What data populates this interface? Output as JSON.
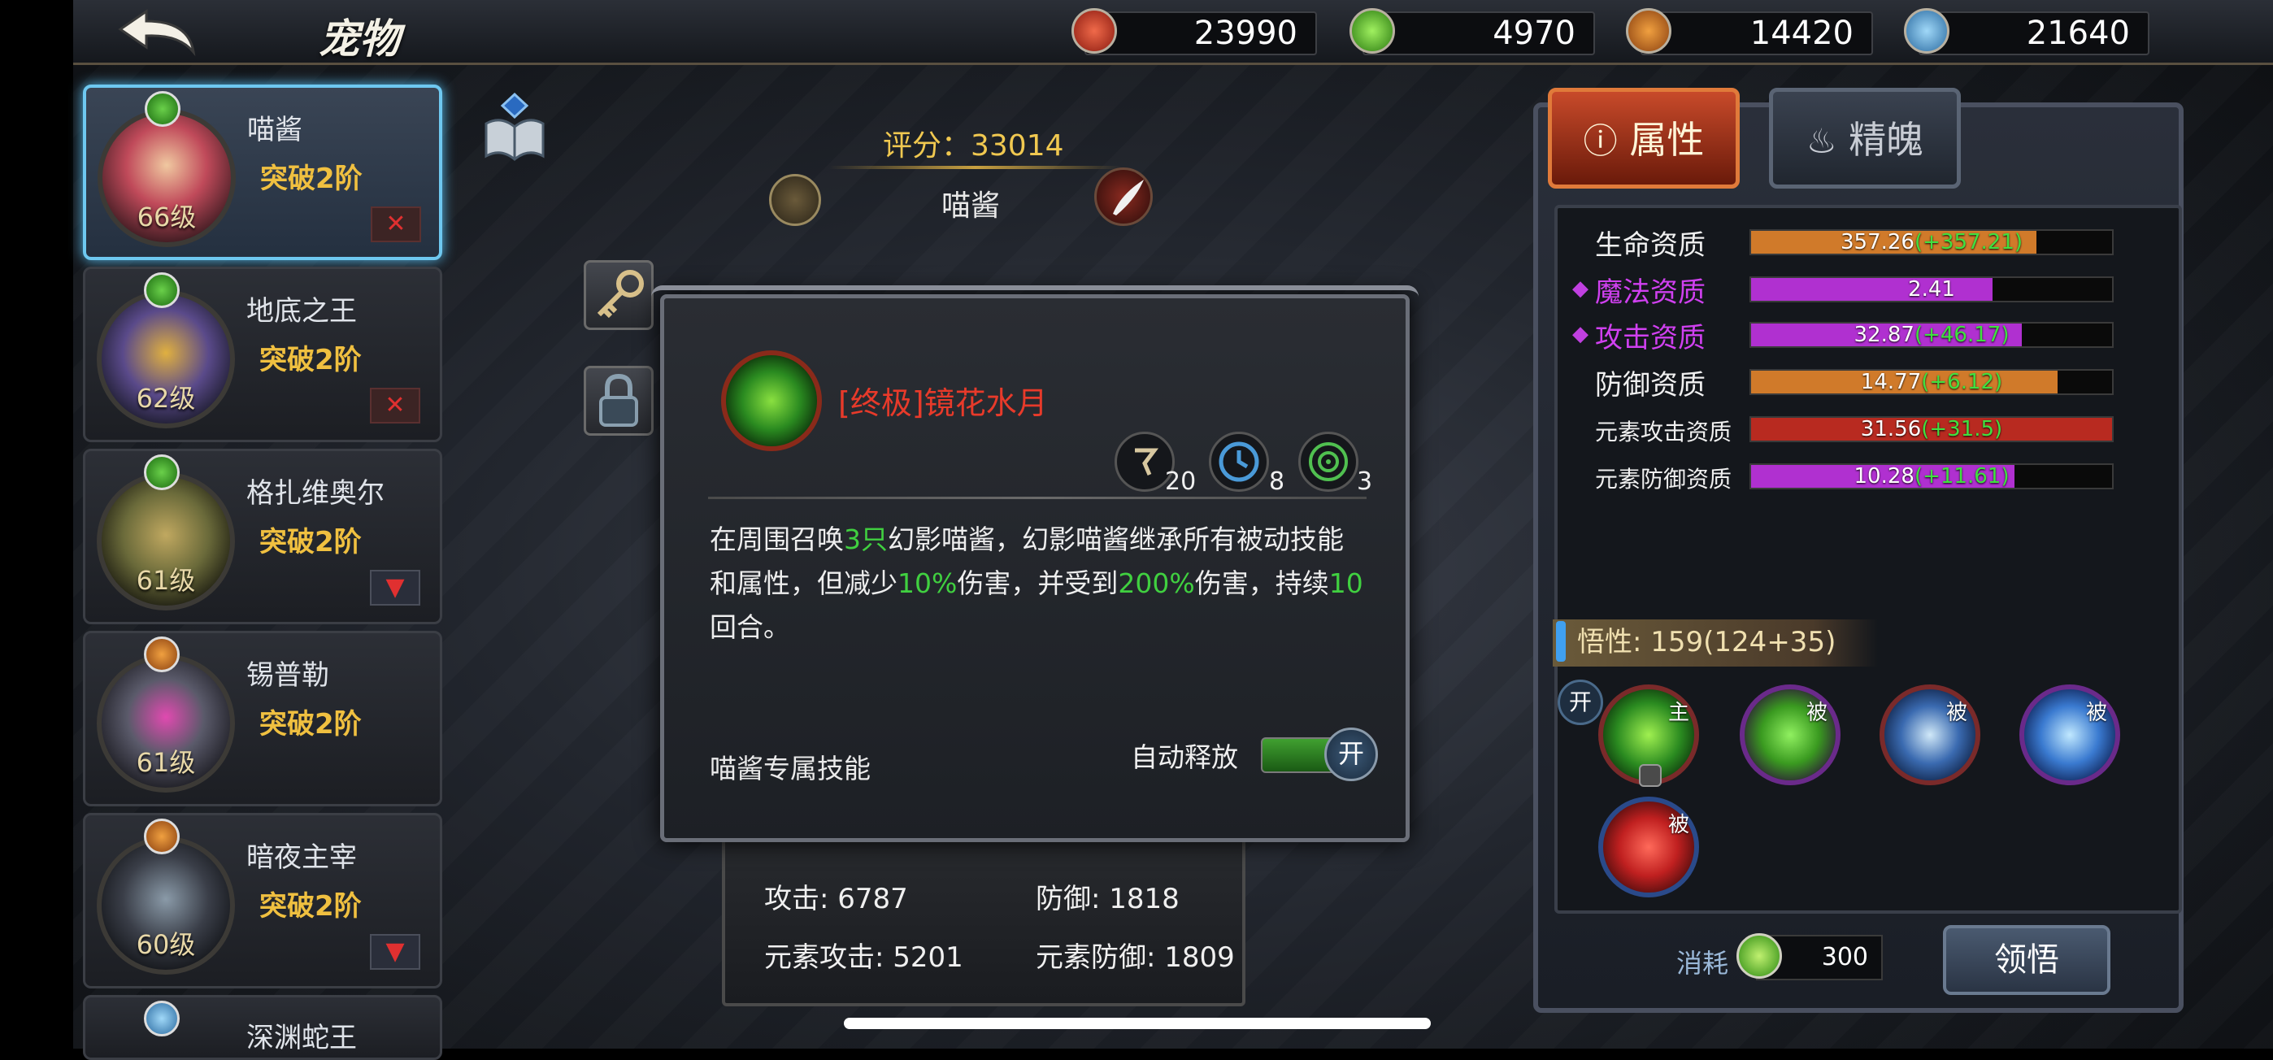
{
  "header": {
    "title": "宠物",
    "resources": [
      {
        "icon": "red-gem-icon",
        "value": "23990",
        "color": "#c83a2a"
      },
      {
        "icon": "green-gem-icon",
        "value": "4970",
        "color": "#4ab030"
      },
      {
        "icon": "lightning-gem-icon",
        "value": "14420",
        "color": "#d07a2a"
      },
      {
        "icon": "snowflake-gem-icon",
        "value": "21640",
        "color": "#4a9ad0"
      }
    ]
  },
  "pets": [
    {
      "name": "喵酱",
      "rank": "突破2阶",
      "level": "66级",
      "element": "water-drop-icon",
      "selected": true
    },
    {
      "name": "地底之王",
      "rank": "突破2阶",
      "level": "62级",
      "element": "water-drop-icon"
    },
    {
      "name": "格扎维奥尔",
      "rank": "突破2阶",
      "level": "61级",
      "element": "water-drop-icon"
    },
    {
      "name": "锡普勒",
      "rank": "突破2阶",
      "level": "61级",
      "element": "lightning-icon"
    },
    {
      "name": "暗夜主宰",
      "rank": "突破2阶",
      "level": "60级",
      "element": "lightning-icon"
    },
    {
      "name": "深渊蛇王",
      "rank": "",
      "level": "",
      "element": "snowflake-icon"
    }
  ],
  "center": {
    "score": "评分：33014",
    "pet_name": "喵酱",
    "stats": {
      "attack": "攻击: 6787",
      "defense": "防御: 1818",
      "elem_attack": "元素攻击: 5201",
      "elem_defense": "元素防御: 1809"
    }
  },
  "skill_popup": {
    "name": "[终极]镜花水月",
    "icon": "swirl-skill-icon",
    "mini_stats": [
      {
        "icon": "rune-icon",
        "value": "20"
      },
      {
        "icon": "clock-icon",
        "value": "8"
      },
      {
        "icon": "target-icon",
        "value": "3"
      }
    ],
    "description": {
      "p1": "在周围召唤",
      "n1": "3只",
      "p2": "幻影喵酱，幻影喵酱继承所有被动技能和属性，但减少",
      "n2": "10%",
      "p3": "伤害，并受到",
      "n3": "200%",
      "p4": "伤害，持续",
      "n4": "10",
      "p5": "回合。"
    },
    "exclusive_label": "喵酱专属技能",
    "auto_label": "自动释放",
    "toggle_label": "开"
  },
  "right_panel": {
    "tabs": [
      {
        "label": "属性",
        "icon": "info-icon",
        "active": true
      },
      {
        "label": "精魄",
        "icon": "flame-icon",
        "active": false
      }
    ],
    "attributes": [
      {
        "label": "生命资质",
        "base": "357.26",
        "bonus": "(+357.21)",
        "fill": 0.79,
        "color": "#d07a2a",
        "magic": false,
        "small": false
      },
      {
        "label": "魔法资质",
        "base": "2.41",
        "bonus": "",
        "fill": 0.67,
        "color": "#b030d0",
        "magic": true,
        "small": false
      },
      {
        "label": "攻击资质",
        "base": "32.87",
        "bonus": "(+46.17)",
        "fill": 0.75,
        "color": "#b030d0",
        "magic": true,
        "small": false
      },
      {
        "label": "防御资质",
        "base": "14.77",
        "bonus": "(+6.12)",
        "fill": 0.85,
        "color": "#d07a2a",
        "magic": false,
        "small": false
      },
      {
        "label": "元素攻击资质",
        "base": "31.56",
        "bonus": "(+31.5)",
        "fill": 1.0,
        "color": "#b82a20",
        "magic": false,
        "small": true
      },
      {
        "label": "元素防御资质",
        "base": "10.28",
        "bonus": "(+11.61)",
        "fill": 0.73,
        "color": "#b030d0",
        "magic": false,
        "small": true
      }
    ],
    "wisdom": "悟性: 159(124+35)",
    "open_badge": "开",
    "skills": [
      {
        "icon": "swirl-skill-icon",
        "tag": "主",
        "locked": true,
        "color": "#40c040"
      },
      {
        "icon": "green-heart-skill-icon",
        "tag": "被",
        "color": "#60d040"
      },
      {
        "icon": "blue-slash-skill-icon",
        "tag": "被",
        "color": "#4a8ad0"
      },
      {
        "icon": "ice-upgrade-skill-icon",
        "tag": "被",
        "color": "#5aa0e0"
      },
      {
        "icon": "red-heart-skill-icon",
        "tag": "被",
        "color": "#d03a3a"
      }
    ],
    "cost_label": "消耗",
    "cost_value": "300",
    "learn_button": "领悟"
  }
}
